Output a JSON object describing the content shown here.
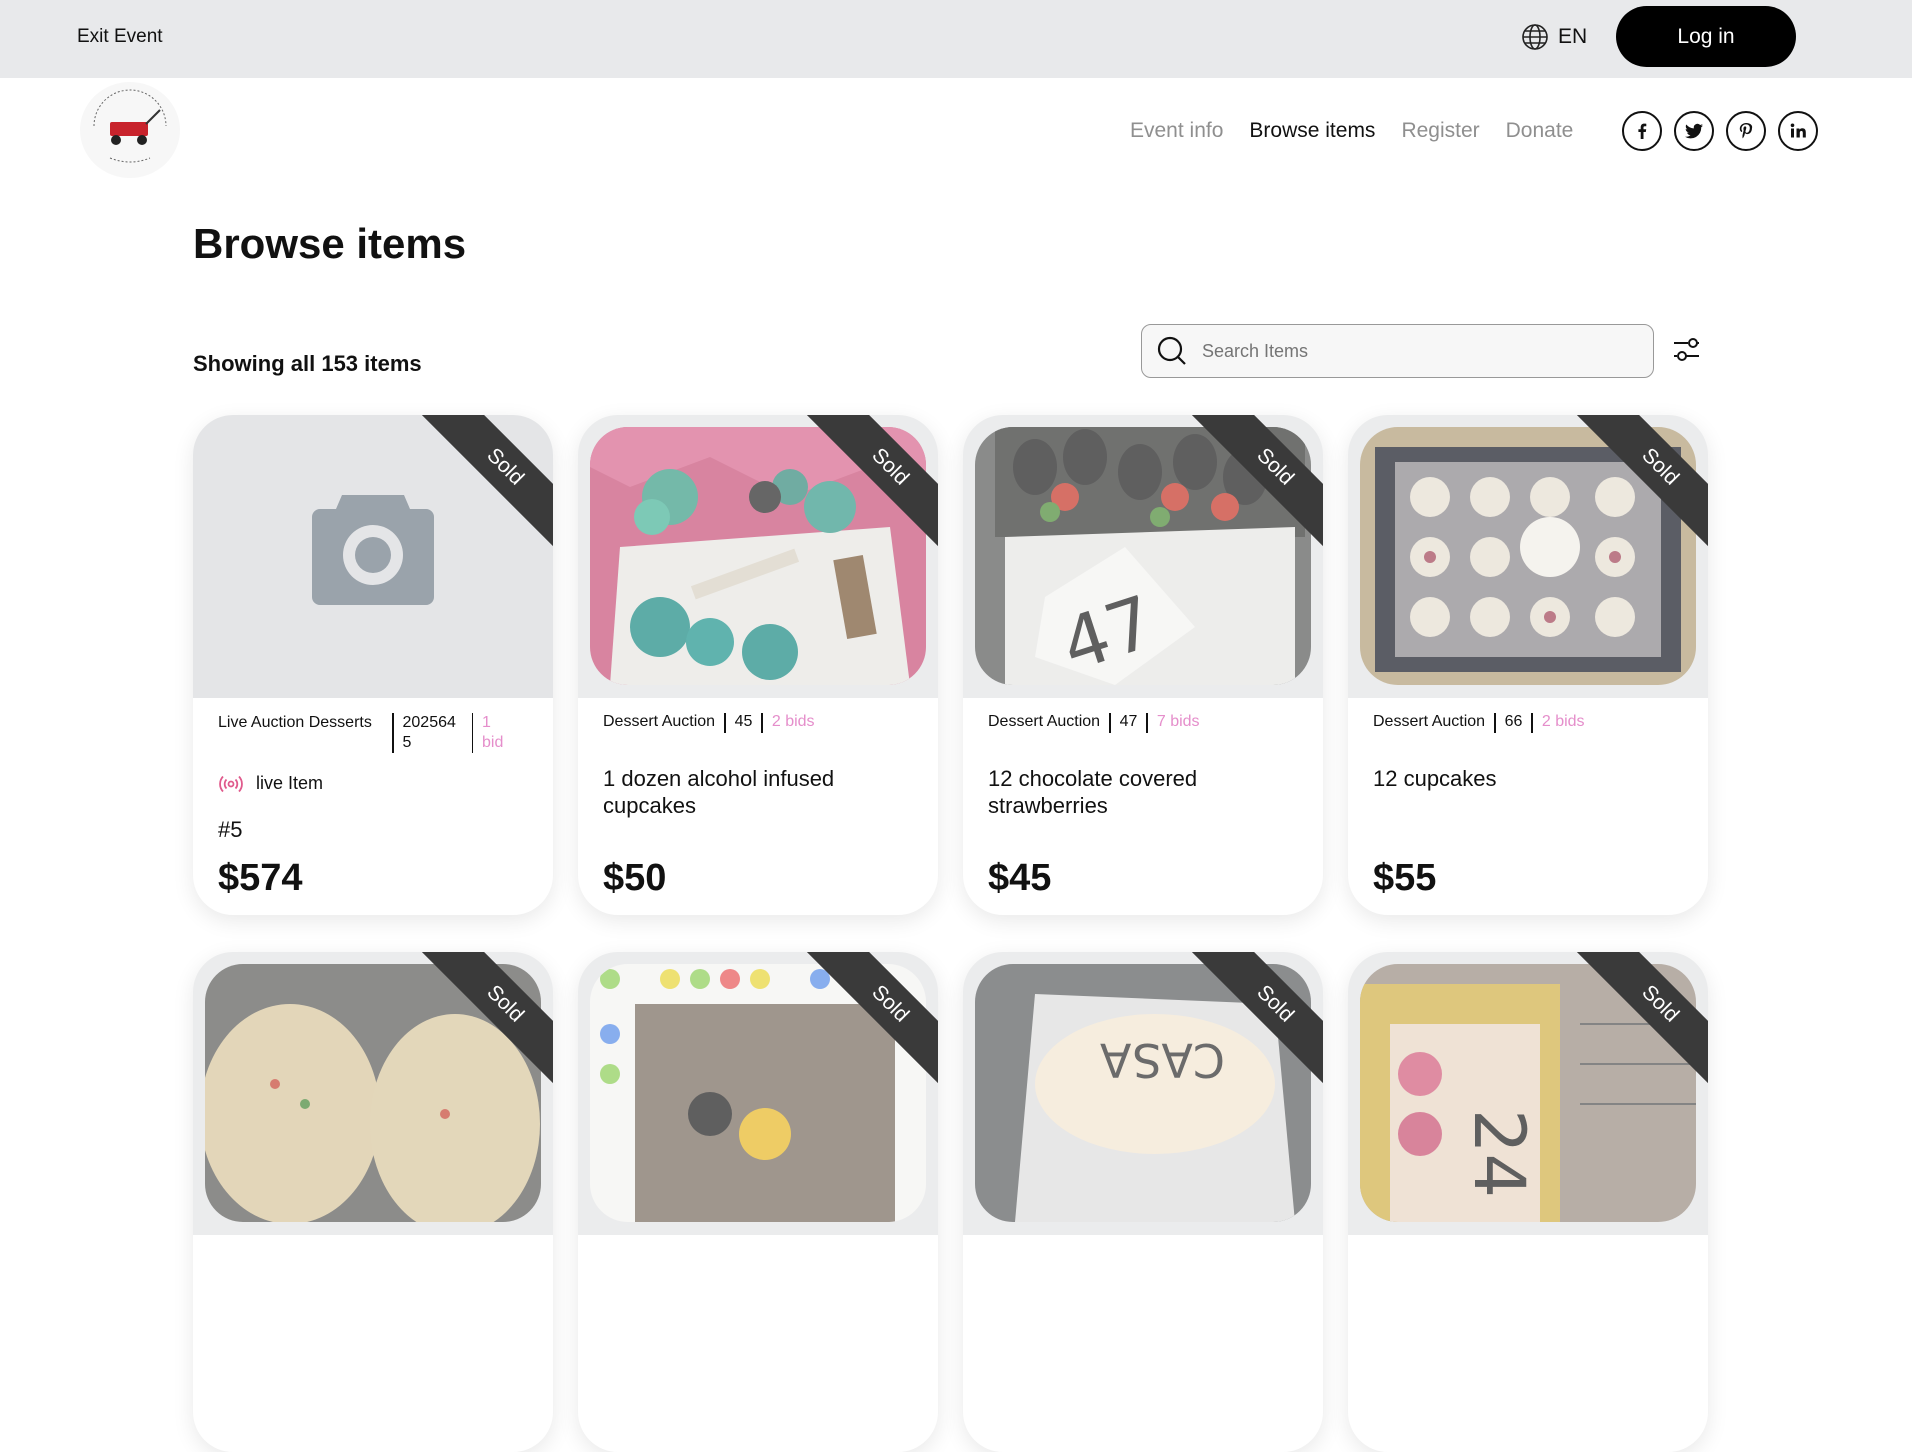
{
  "topbar": {
    "exit_label": "Exit Event",
    "lang": "EN",
    "login_label": "Log in"
  },
  "nav": {
    "items": [
      "Event info",
      "Browse items",
      "Register",
      "Donate"
    ],
    "active": "Browse items"
  },
  "social": [
    "facebook-icon",
    "twitter-icon",
    "pinterest-icon",
    "linkedin-icon"
  ],
  "page": {
    "title": "Browse items",
    "showing": "Showing all 153 items"
  },
  "search": {
    "placeholder": "Search Items"
  },
  "cards": [
    {
      "category": "Live Auction Desserts",
      "number": "2025645",
      "bids": "1 bid",
      "live_label": "live Item",
      "lot": "#5",
      "name": "",
      "price": "$574",
      "status": "Sold"
    },
    {
      "category": "Dessert Auction",
      "number": "45",
      "bids": "2 bids",
      "name": "1 dozen alcohol infused cupcakes",
      "price": "$50",
      "status": "Sold"
    },
    {
      "category": "Dessert Auction",
      "number": "47",
      "bids": "7 bids",
      "name": "12 chocolate covered strawberries",
      "price": "$45",
      "status": "Sold"
    },
    {
      "category": "Dessert Auction",
      "number": "66",
      "bids": "2 bids",
      "name": "12 cupcakes",
      "price": "$55",
      "status": "Sold"
    },
    {
      "status": "Sold"
    },
    {
      "status": "Sold"
    },
    {
      "status": "Sold"
    },
    {
      "status": "Sold"
    }
  ]
}
